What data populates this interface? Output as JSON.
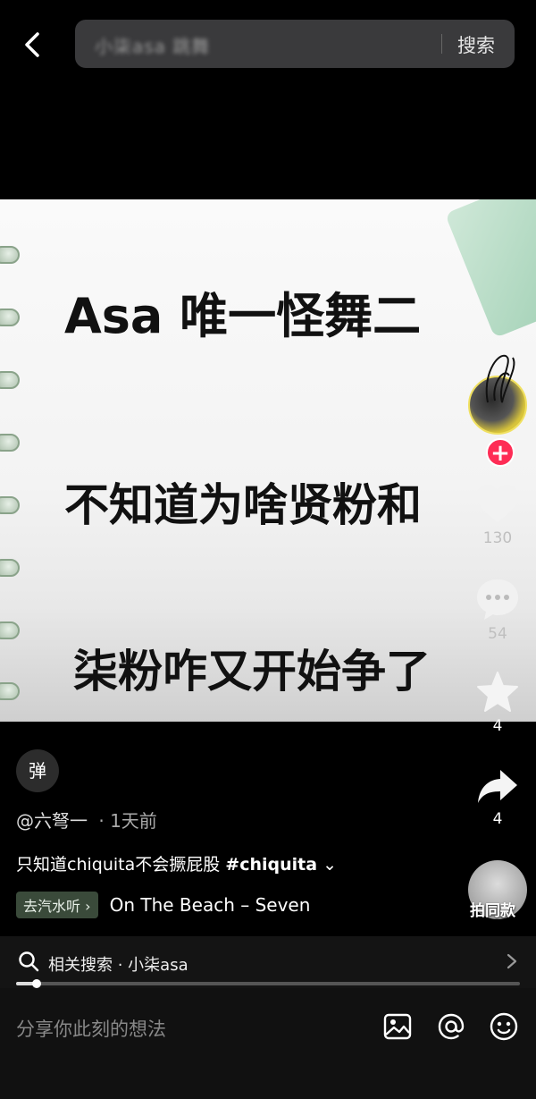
{
  "search": {
    "query": "小柒asa 跳舞",
    "button": "搜索"
  },
  "video_card": {
    "line1": "Asa 唯一怪舞二",
    "line2": "不知道为啥贤粉和",
    "line3": "柒粉咋又开始争了"
  },
  "actions": {
    "like_count": "130",
    "comment_count": "54",
    "favorite_count": "4",
    "share_count": "4"
  },
  "danmu": "弹",
  "author": {
    "name": "@六弩一",
    "time": "· 1天前"
  },
  "caption": {
    "text": "只知道chiquita不会撅屁股 ",
    "hashtag": "#chiquita",
    "expand": "⌄"
  },
  "music": {
    "badge": "去汽水听 ›",
    "title": "On The Beach – Seven"
  },
  "same_style": "拍同款",
  "related": {
    "label": "相关搜索 · 小柒asa"
  },
  "progress": {
    "fraction": 0.04
  },
  "comment": {
    "placeholder": "分享你此刻的想法"
  }
}
